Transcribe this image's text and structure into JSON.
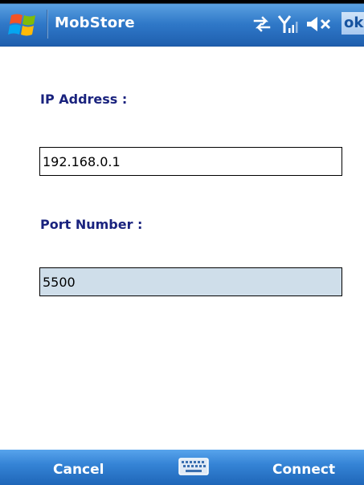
{
  "title_bar": {
    "app_title": "MobStore",
    "start_icon": "windows-flag-icon",
    "status_icons": [
      "connectivity-icon",
      "signal-strength-icon",
      "volume-muted-icon"
    ],
    "ok_label": "ok"
  },
  "form": {
    "ip_label": "IP Address :",
    "ip_value": "192.168.0.1",
    "port_label": "Port Number :",
    "port_value": "5500"
  },
  "softkeys": {
    "left_label": "Cancel",
    "center_icon": "keyboard-icon",
    "right_label": "Connect"
  },
  "colors": {
    "titlebar": "#2f78c8",
    "label_text": "#1a237e",
    "port_field_bg": "#cfdeea",
    "softbar": "#3584d6"
  }
}
